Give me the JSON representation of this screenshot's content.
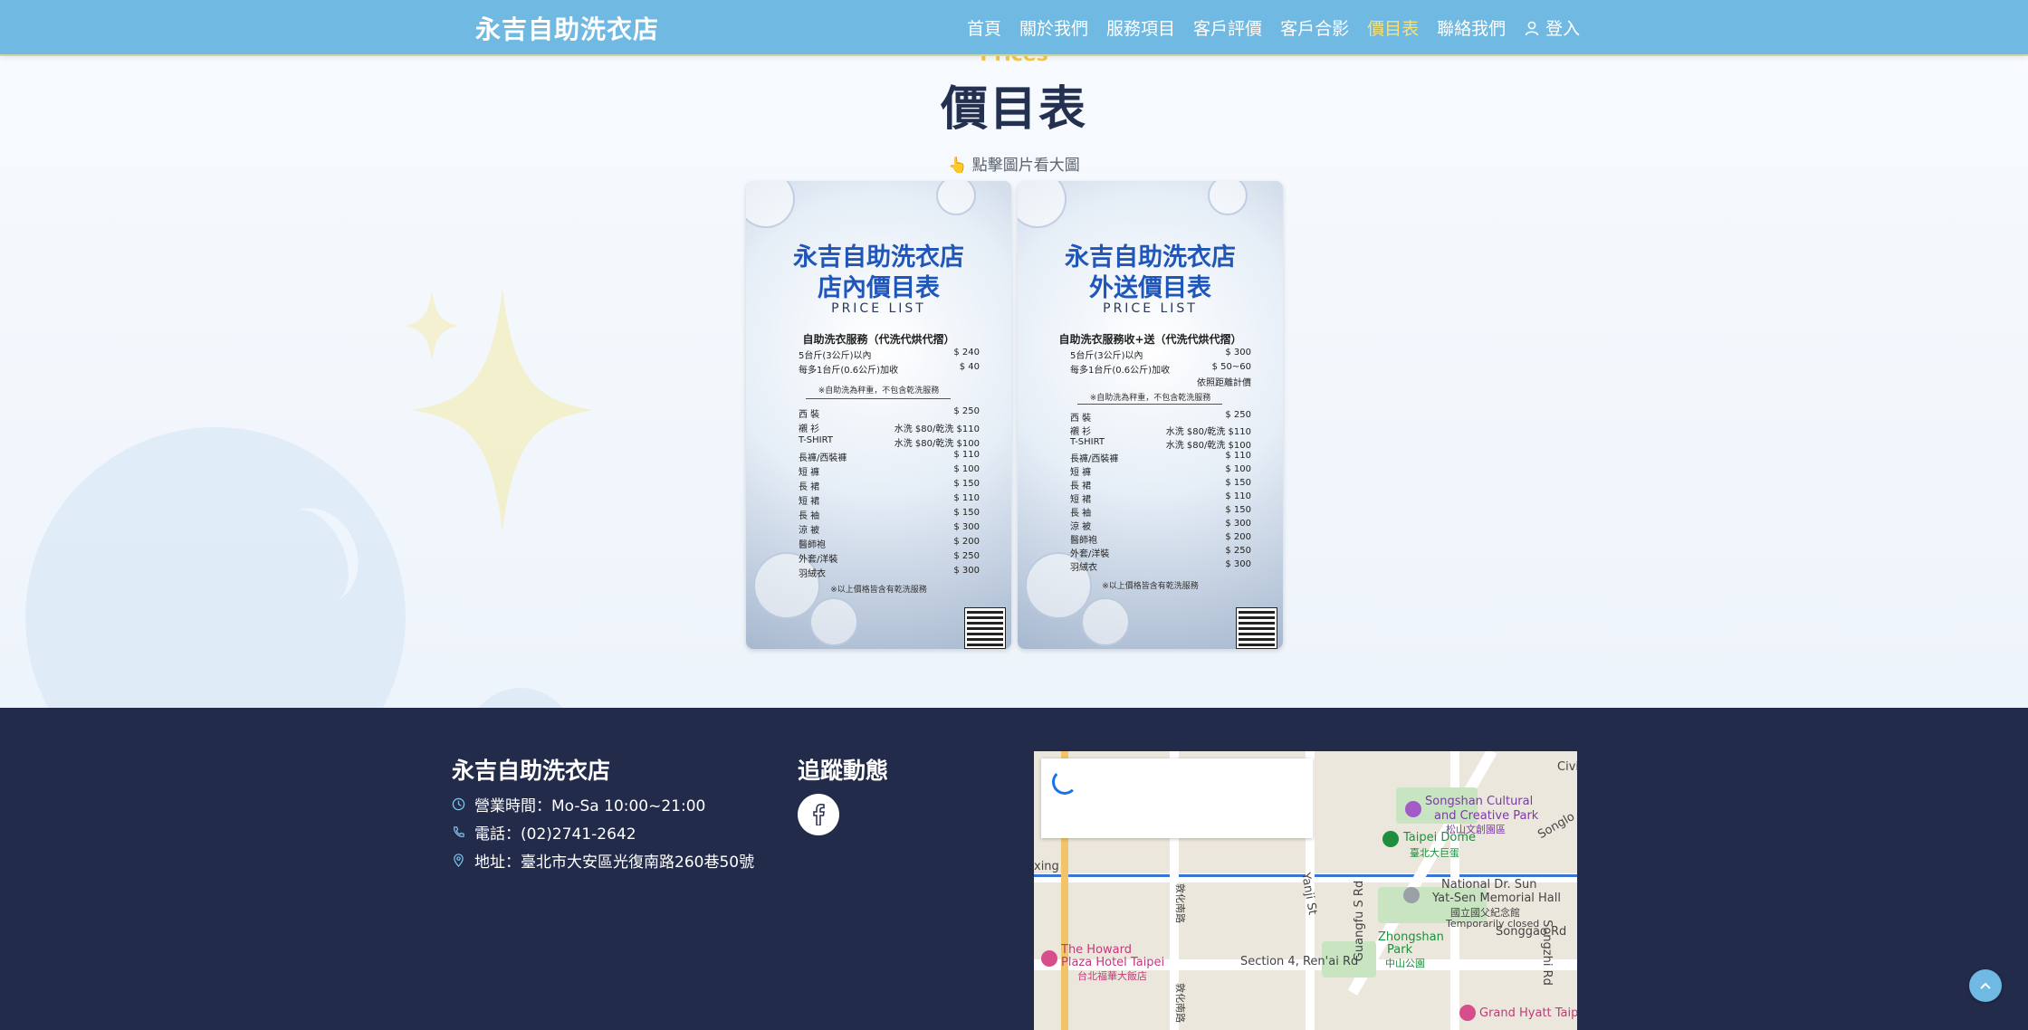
{
  "header": {
    "brand": "永吉自助洗衣店",
    "nav": [
      "首頁",
      "關於我們",
      "服務項目",
      "客戶評價",
      "客戶合影",
      "價目表",
      "聯絡我們"
    ],
    "active_nav": "價目表",
    "login_label": "登入",
    "icons": {
      "login": "user-icon"
    }
  },
  "prices": {
    "subtitle": "Prices",
    "title": "價目表",
    "hint": "👆 點擊圖片看大圖",
    "cards": [
      {
        "title_line1": "永吉自助洗衣店",
        "title_line2": "店內價目表",
        "price_list": "PRICE LIST",
        "service": "自助洗衣服務（代洗代烘代摺）",
        "base_rows": [
          {
            "label": "5台斤(3公斤)以內",
            "price": "$ 240"
          },
          {
            "label": "每多1台斤(0.6公斤)加收",
            "price": "$ 40"
          }
        ],
        "note_top": "※自助洗為秤重，不包含乾洗服務",
        "items": [
          {
            "label": "西 裝",
            "price": "$ 250"
          },
          {
            "label": "襯 衫",
            "price": "水洗 $80/乾洗 $110"
          },
          {
            "label": "T-SHIRT",
            "price": "水洗 $80/乾洗 $100"
          },
          {
            "label": "長褲/西裝褲",
            "price": "$ 110"
          },
          {
            "label": "短 褲",
            "price": "$ 100"
          },
          {
            "label": "長 裙",
            "price": "$ 150"
          },
          {
            "label": "短 裙",
            "price": "$ 110"
          },
          {
            "label": "長 袖",
            "price": "$ 150"
          },
          {
            "label": "涼 被",
            "price": "$ 300"
          },
          {
            "label": "醫師袍",
            "price": "$ 200"
          },
          {
            "label": "外套/洋裝",
            "price": "$ 250"
          },
          {
            "label": "羽絨衣",
            "price": "$ 300"
          }
        ],
        "note_bottom": "※以上價格皆含有乾洗服務"
      },
      {
        "title_line1": "永吉自助洗衣店",
        "title_line2": "外送價目表",
        "price_list": "PRICE LIST",
        "service": "自助洗衣服務收+送（代洗代烘代摺）",
        "base_rows": [
          {
            "label": "5台斤(3公斤)以內",
            "price": "$ 300"
          },
          {
            "label": "每多1台斤(0.6公斤)加收",
            "price": "$ 50~60"
          },
          {
            "label": "",
            "price": "依照距離計價"
          }
        ],
        "note_top": "※自助洗為秤重，不包含乾洗服務",
        "items": [
          {
            "label": "西 裝",
            "price": "$ 250"
          },
          {
            "label": "襯 衫",
            "price": "水洗 $80/乾洗 $110"
          },
          {
            "label": "T-SHIRT",
            "price": "水洗 $80/乾洗 $100"
          },
          {
            "label": "長褲/西裝褲",
            "price": "$ 110"
          },
          {
            "label": "短 褲",
            "price": "$ 100"
          },
          {
            "label": "長 裙",
            "price": "$ 150"
          },
          {
            "label": "短 裙",
            "price": "$ 110"
          },
          {
            "label": "長 袖",
            "price": "$ 150"
          },
          {
            "label": "涼 被",
            "price": "$ 300"
          },
          {
            "label": "醫師袍",
            "price": "$ 200"
          },
          {
            "label": "外套/洋裝",
            "price": "$ 250"
          },
          {
            "label": "羽絨衣",
            "price": "$ 300"
          }
        ],
        "note_bottom": "※以上價格皆含有乾洗服務"
      }
    ]
  },
  "footer": {
    "brand": "永吉自助洗衣店",
    "hours": "營業時間：Mo-Sa 10:00~21:00",
    "phone": "電話：(02)2741-2642",
    "address": "地址：臺北市大安區光復南路260巷50號",
    "follow_title": "追蹤動態",
    "social": [
      "facebook-icon"
    ]
  },
  "map": {
    "labels": {
      "songshan": "Songshan Cultural",
      "songshan2": "and Creative Park",
      "songshan_zh": "松山文創園區",
      "dome": "Taipei Dome",
      "dome_zh": "臺北大巨蛋",
      "sysmh1": "National Dr. Sun",
      "sysmh2": "Yat-Sen Memorial Hall",
      "sysmh_zh": "國立國父紀念館",
      "temp_closed": "Temporarily closed",
      "zhongshan": "Zhongshan",
      "zhongshan2": "Park",
      "zhongshan_zh": "中山公園",
      "songgao": "Songgao Rd",
      "howard1": "The Howard",
      "howard2": "Plaza Hotel Taipei",
      "howard_zh": "台北福華大飯店",
      "renai": "Section 4, Ren'ai Rd",
      "yanji": "Yanji St",
      "guangfu": "Guangfu S Rd",
      "grandhyatt": "Grand Hyatt Taip",
      "songzhi": "Songzhi Rd",
      "dunhua1": "敦化南路",
      "dunhua2": "敦化南路",
      "zhongxiao": "xing",
      "civic": "Civi",
      "songlo": "Songlo"
    }
  },
  "colors": {
    "header_bg": "#6fb9e2",
    "active_nav": "#f7e27a",
    "footer_bg": "#232b4b",
    "title": "#23304f",
    "subtitle": "#f2c94c"
  }
}
